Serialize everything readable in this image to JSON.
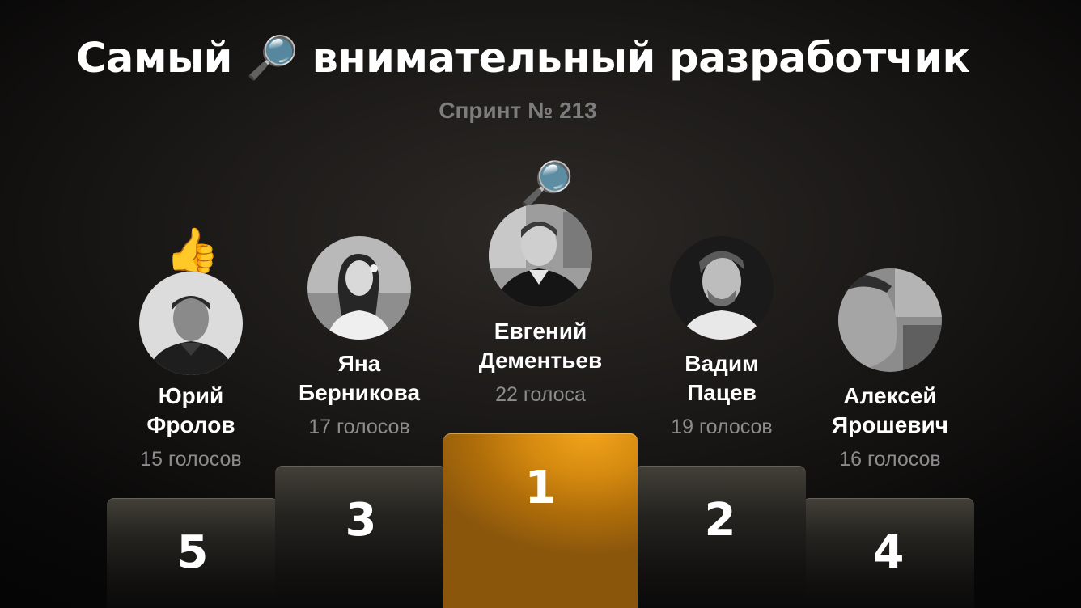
{
  "title": {
    "before": "Самый",
    "icon": "magnifying-glass-emoji",
    "icon_glyph": "🔎",
    "after": "внимательный разработчик"
  },
  "subtitle": "Спринт № 213",
  "colors": {
    "accent_gold": "#e0950f",
    "muted_text": "#8c8c8c",
    "subtitle_text": "#7d7d7d"
  },
  "leaderboard": [
    {
      "place": "5",
      "name_line1": "Юрий",
      "name_line2": "Фролов",
      "votes": "15 голосов",
      "badge": "thumbs-up-emoji",
      "badge_glyph": "👍"
    },
    {
      "place": "3",
      "name_line1": "Яна",
      "name_line2": "Берникова",
      "votes": "17 голосов"
    },
    {
      "place": "1",
      "name_line1": "Евгений",
      "name_line2": "Дементьев",
      "votes": "22 голоса",
      "badge": "magnifying-glass-emoji",
      "badge_glyph": "🔎"
    },
    {
      "place": "2",
      "name_line1": "Вадим",
      "name_line2": "Пацев",
      "votes": "19 голосов"
    },
    {
      "place": "4",
      "name_line1": "Алексей",
      "name_line2": "Ярошевич",
      "votes": "16 голосов"
    }
  ]
}
